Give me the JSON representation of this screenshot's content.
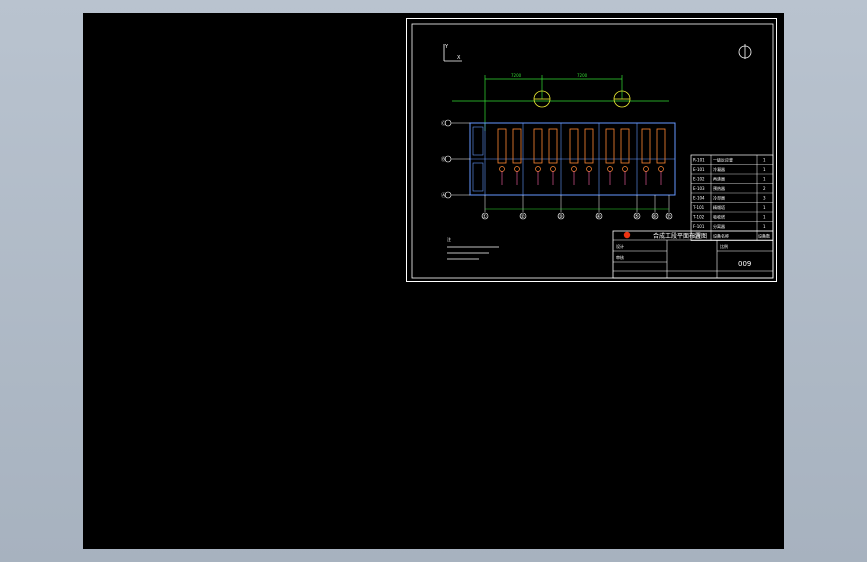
{
  "drawing": {
    "top_dimensions": [
      "7200",
      "7200"
    ],
    "grid_rows": [
      "Ⓒ",
      "Ⓑ",
      "Ⓐ"
    ],
    "grid_cols": [
      "①",
      "②",
      "③",
      "④",
      "⑤",
      "⑥",
      "⑦"
    ]
  },
  "equipment_list": [
    {
      "tag": "R-101",
      "name": "一级反应釜",
      "qty": "1"
    },
    {
      "tag": "E-101",
      "name": "冷凝器",
      "qty": "1"
    },
    {
      "tag": "E-102",
      "name": "再沸器",
      "qty": "1"
    },
    {
      "tag": "E-103",
      "name": "预热器",
      "qty": "2"
    },
    {
      "tag": "E-104",
      "name": "冷却器",
      "qty": "3"
    },
    {
      "tag": "T-101",
      "name": "精馏塔",
      "qty": "1"
    },
    {
      "tag": "T-102",
      "name": "吸收塔",
      "qty": "1"
    },
    {
      "tag": "F-101",
      "name": "分离器",
      "qty": "1"
    }
  ],
  "equipment_header": {
    "tag": "位号",
    "name": "设备名称",
    "qty": "设备数"
  },
  "title_block": {
    "title": "合成工段平面布置图",
    "drawing_no": "009",
    "design_label": "设计",
    "check_label": "审核",
    "scale_label": "比例"
  },
  "notes_label": "注"
}
